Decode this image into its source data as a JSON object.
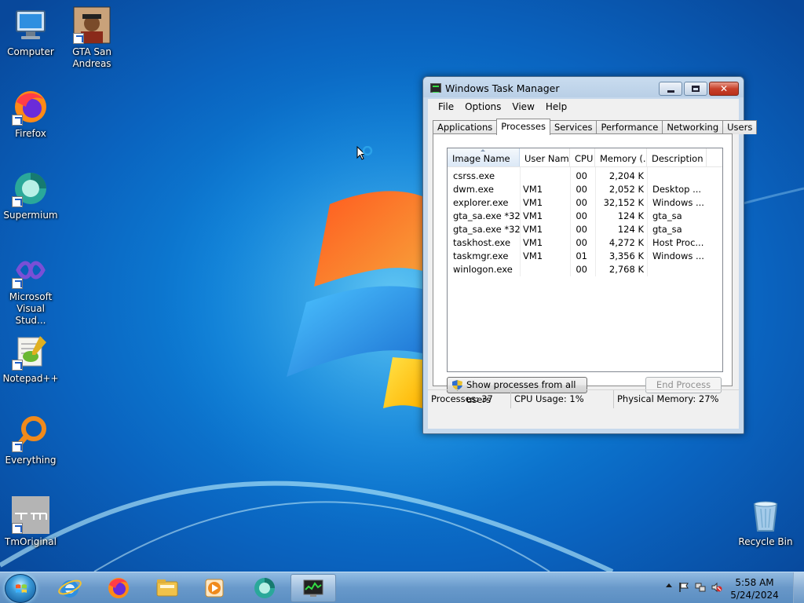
{
  "desktop": {
    "icons": [
      {
        "label": "Computer",
        "icon": "computer-icon"
      },
      {
        "label": "GTA San Andreas",
        "icon": "gta-icon"
      },
      {
        "label": "Firefox",
        "icon": "firefox-icon"
      },
      {
        "label": "Supermium",
        "icon": "supermium-icon"
      },
      {
        "label": "Microsoft Visual Stud...",
        "icon": "visual-studio-icon"
      },
      {
        "label": "Notepad++",
        "icon": "notepadpp-icon"
      },
      {
        "label": "Everything",
        "icon": "everything-icon"
      },
      {
        "label": "TmOriginal",
        "icon": "tmoriginal-icon"
      },
      {
        "label": "Recycle Bin",
        "icon": "recycle-bin-icon"
      }
    ]
  },
  "window": {
    "title": "Windows Task Manager",
    "menu": [
      "File",
      "Options",
      "View",
      "Help"
    ],
    "tabs": [
      "Applications",
      "Processes",
      "Services",
      "Performance",
      "Networking",
      "Users"
    ],
    "active_tab": "Processes",
    "columns": [
      "Image Name",
      "User Name",
      "CPU",
      "Memory (...",
      "Description"
    ],
    "rows": [
      {
        "image": "csrss.exe",
        "user": "",
        "cpu": "00",
        "memory": "2,204 K",
        "desc": ""
      },
      {
        "image": "dwm.exe",
        "user": "VM1",
        "cpu": "00",
        "memory": "2,052 K",
        "desc": "Desktop ..."
      },
      {
        "image": "explorer.exe",
        "user": "VM1",
        "cpu": "00",
        "memory": "32,152 K",
        "desc": "Windows ..."
      },
      {
        "image": "gta_sa.exe *32",
        "user": "VM1",
        "cpu": "00",
        "memory": "124 K",
        "desc": "gta_sa"
      },
      {
        "image": "gta_sa.exe *32",
        "user": "VM1",
        "cpu": "00",
        "memory": "124 K",
        "desc": "gta_sa"
      },
      {
        "image": "taskhost.exe",
        "user": "VM1",
        "cpu": "00",
        "memory": "4,272 K",
        "desc": "Host Proc..."
      },
      {
        "image": "taskmgr.exe",
        "user": "VM1",
        "cpu": "01",
        "memory": "3,356 K",
        "desc": "Windows ..."
      },
      {
        "image": "winlogon.exe",
        "user": "",
        "cpu": "00",
        "memory": "2,768 K",
        "desc": ""
      }
    ],
    "show_all_label": "Show processes from all users",
    "end_process_label": "End Process",
    "status": {
      "processes": "Processes: 37",
      "cpu": "CPU Usage: 1%",
      "memory": "Physical Memory: 27%"
    }
  },
  "taskbar": {
    "pinned": [
      "internet-explorer-icon",
      "firefox-icon",
      "file-explorer-icon",
      "media-player-icon",
      "supermium-icon",
      "task-manager-icon"
    ],
    "clock_time": "5:58 AM",
    "clock_date": "5/24/2024"
  },
  "colors": {
    "accent": "#0a63bf",
    "close_button": "#c8412b"
  }
}
